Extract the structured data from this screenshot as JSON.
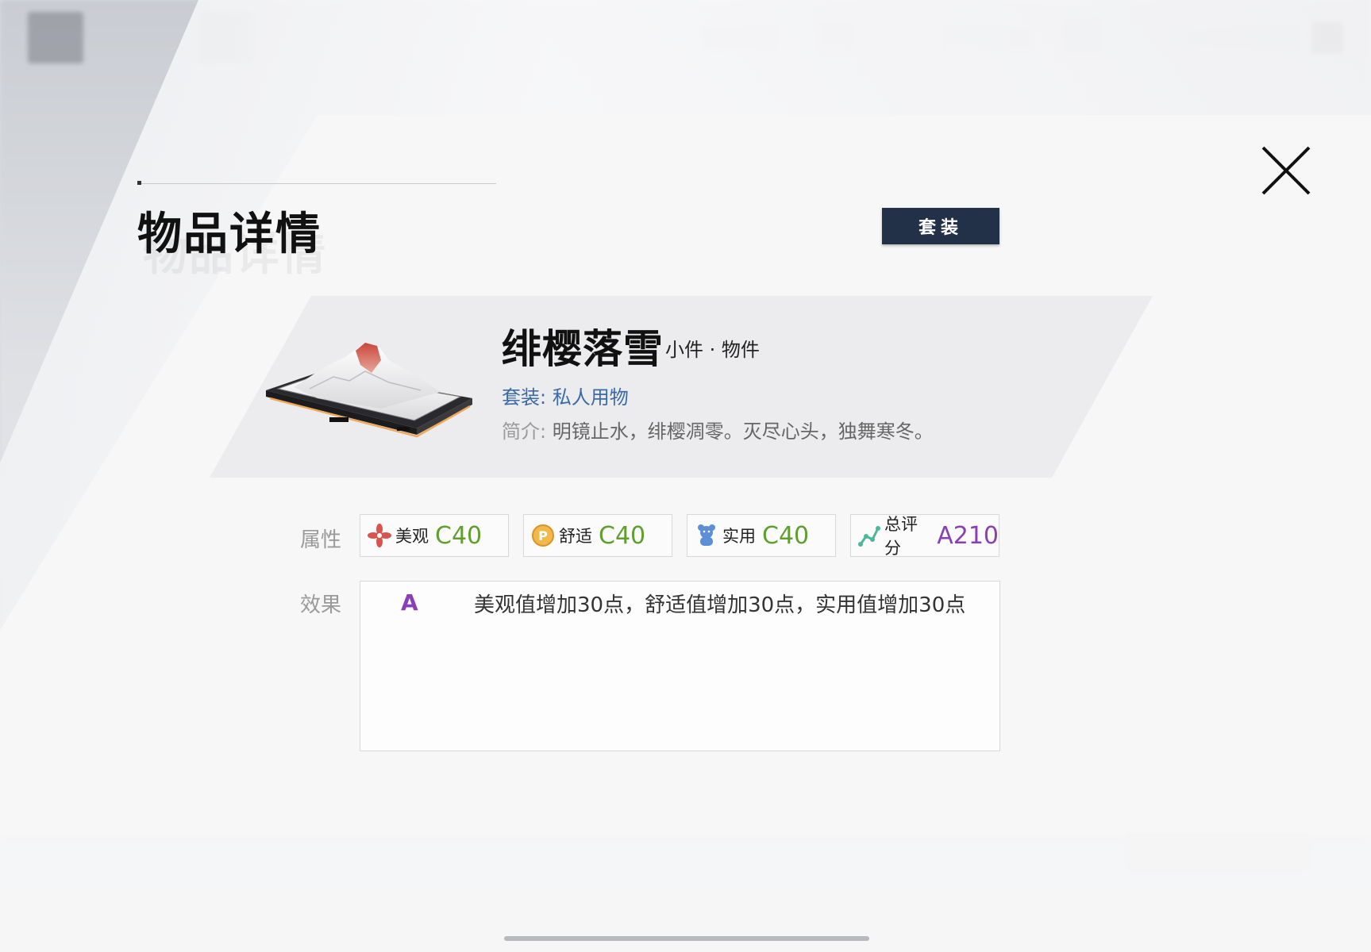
{
  "dialog": {
    "title": "物品详情",
    "set_button_label": "套装",
    "close_icon": "close-icon"
  },
  "item": {
    "name": "绯樱落雪",
    "category": "小件 · 物件",
    "set": "套装: 私人用物",
    "desc_label": "简介:",
    "desc": "明镜止水，绯樱凋零。灭尽心头，独舞寒冬。",
    "image_icon": "snow-mountain-tray-image"
  },
  "attributes": {
    "label": "属性",
    "items": [
      {
        "name": "美观",
        "value": "C40",
        "icon": "flower-icon"
      },
      {
        "name": "舒适",
        "value": "C40",
        "icon": "coin-icon"
      },
      {
        "name": "实用",
        "value": "C40",
        "icon": "bear-icon"
      },
      {
        "name": "总评分",
        "value": "A210",
        "icon": "chart-icon"
      }
    ]
  },
  "effect": {
    "label": "效果",
    "grade": "A",
    "text": "美观值增加30点，舒适值增加30点，实用值增加30点"
  },
  "colors": {
    "set_button_bg": "#223148",
    "set_text": "#3b6aa6",
    "grade_c": "#5f9f2e",
    "grade_a": "#8a3fb5"
  }
}
